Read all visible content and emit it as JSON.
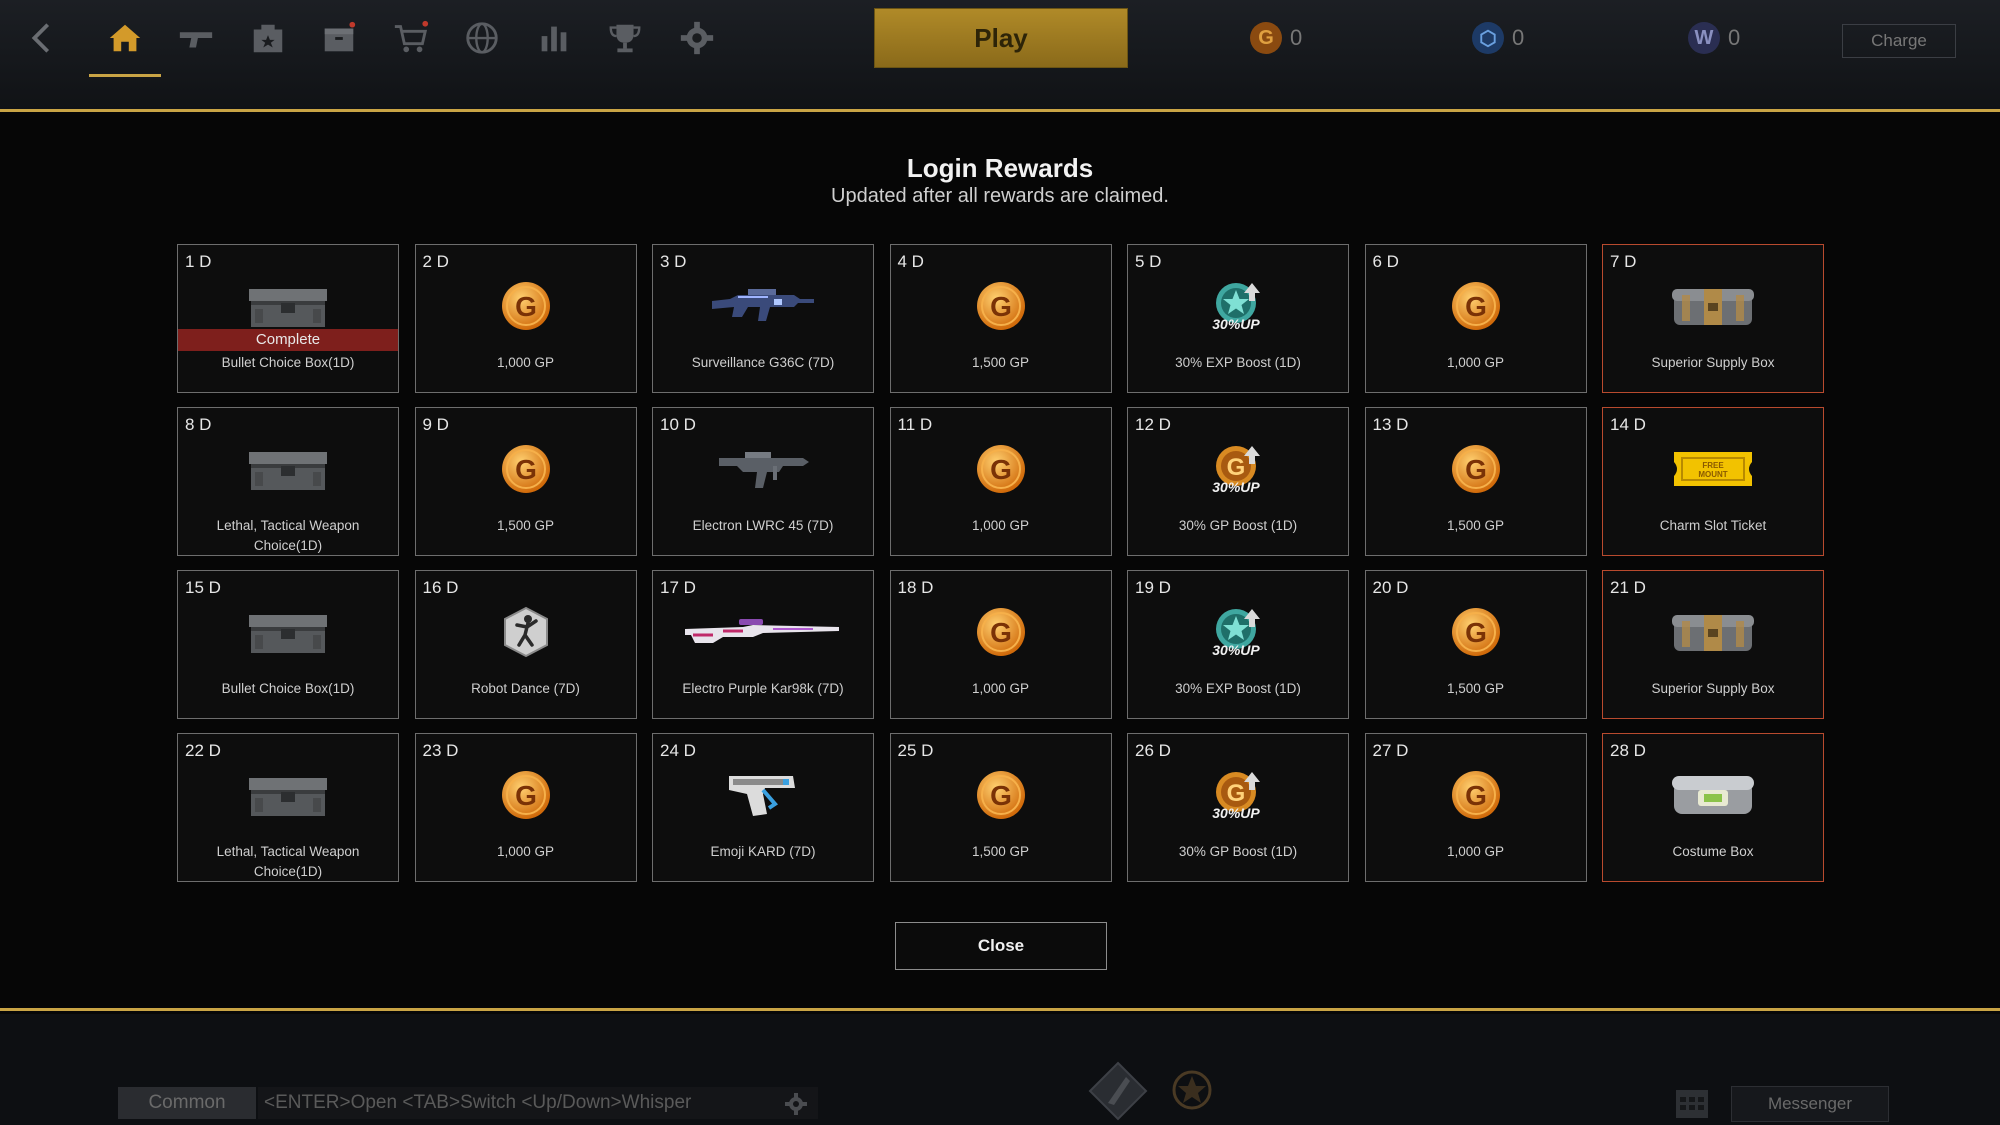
{
  "topbar": {
    "nav_icons": [
      "back-icon",
      "home-icon",
      "weapon-icon",
      "armory-icon",
      "inventory-icon",
      "shop-icon",
      "globe-icon",
      "stats-icon",
      "trophy-icon",
      "gear-icon"
    ],
    "play_label": "Play",
    "currencies": [
      {
        "symbol": "G",
        "value": "0",
        "color": "#c06a12"
      },
      {
        "symbol": "⬡",
        "value": "0",
        "color": "#2a4f8a"
      },
      {
        "symbol": "W",
        "value": "0",
        "color": "#3a3f6a"
      }
    ],
    "charge_label": "Charge"
  },
  "modal": {
    "title": "Login Rewards",
    "subtitle": "Updated after all rewards are claimed.",
    "complete_label": "Complete",
    "close_label": "Close",
    "rewards": [
      {
        "day": "1 D",
        "label": "Bullet Choice Box(1D)",
        "icon": "crate-icon",
        "special": false,
        "complete": true
      },
      {
        "day": "2 D",
        "label": "1,000 GP",
        "icon": "gp-coin-icon",
        "special": false
      },
      {
        "day": "3 D",
        "label": "Surveillance G36C (7D)",
        "icon": "rifle-icon",
        "special": false
      },
      {
        "day": "4 D",
        "label": "1,500 GP",
        "icon": "gp-coin-icon",
        "special": false
      },
      {
        "day": "5 D",
        "label": "30% EXP Boost (1D)",
        "icon": "exp-boost-icon",
        "special": false
      },
      {
        "day": "6 D",
        "label": "1,000 GP",
        "icon": "gp-coin-icon",
        "special": false
      },
      {
        "day": "7 D",
        "label": "Superior Supply Box",
        "icon": "supply-box-icon",
        "special": true
      },
      {
        "day": "8 D",
        "label": "Lethal, Tactical Weapon Choice(1D)",
        "icon": "crate-icon",
        "special": false
      },
      {
        "day": "9 D",
        "label": "1,500 GP",
        "icon": "gp-coin-icon",
        "special": false
      },
      {
        "day": "10 D",
        "label": "Electron LWRC 45 (7D)",
        "icon": "smg-icon",
        "special": false
      },
      {
        "day": "11 D",
        "label": "1,000 GP",
        "icon": "gp-coin-icon",
        "special": false
      },
      {
        "day": "12 D",
        "label": "30% GP Boost (1D)",
        "icon": "gp-boost-icon",
        "special": false
      },
      {
        "day": "13 D",
        "label": "1,500 GP",
        "icon": "gp-coin-icon",
        "special": false
      },
      {
        "day": "14 D",
        "label": "Charm Slot Ticket",
        "icon": "ticket-icon",
        "special": true
      },
      {
        "day": "15 D",
        "label": "Bullet Choice Box(1D)",
        "icon": "crate-icon",
        "special": false
      },
      {
        "day": "16 D",
        "label": "Robot Dance (7D)",
        "icon": "dance-emote-icon",
        "special": false
      },
      {
        "day": "17 D",
        "label": "Electro Purple Kar98k (7D)",
        "icon": "sniper-rifle-icon",
        "special": false
      },
      {
        "day": "18 D",
        "label": "1,000 GP",
        "icon": "gp-coin-icon",
        "special": false
      },
      {
        "day": "19 D",
        "label": "30% EXP Boost (1D)",
        "icon": "exp-boost-icon",
        "special": false
      },
      {
        "day": "20 D",
        "label": "1,500 GP",
        "icon": "gp-coin-icon",
        "special": false
      },
      {
        "day": "21 D",
        "label": "Superior Supply Box",
        "icon": "supply-box-icon",
        "special": true
      },
      {
        "day": "22 D",
        "label": "Lethal, Tactical Weapon Choice(1D)",
        "icon": "crate-icon",
        "special": false
      },
      {
        "day": "23 D",
        "label": "1,000 GP",
        "icon": "gp-coin-icon",
        "special": false
      },
      {
        "day": "24 D",
        "label": "Emoji KARD (7D)",
        "icon": "pistol-icon",
        "special": false
      },
      {
        "day": "25 D",
        "label": "1,500 GP",
        "icon": "gp-coin-icon",
        "special": false
      },
      {
        "day": "26 D",
        "label": "30% GP Boost (1D)",
        "icon": "gp-boost-icon",
        "special": false
      },
      {
        "day": "27 D",
        "label": "1,000 GP",
        "icon": "gp-coin-icon",
        "special": false
      },
      {
        "day": "28 D",
        "label": "Costume Box",
        "icon": "costume-box-icon",
        "special": true
      }
    ]
  },
  "bottombar": {
    "chat_tab": "Common",
    "chat_hint": "<ENTER>Open <TAB>Switch <Up/Down>Whisper",
    "messenger_label": "Messenger"
  }
}
